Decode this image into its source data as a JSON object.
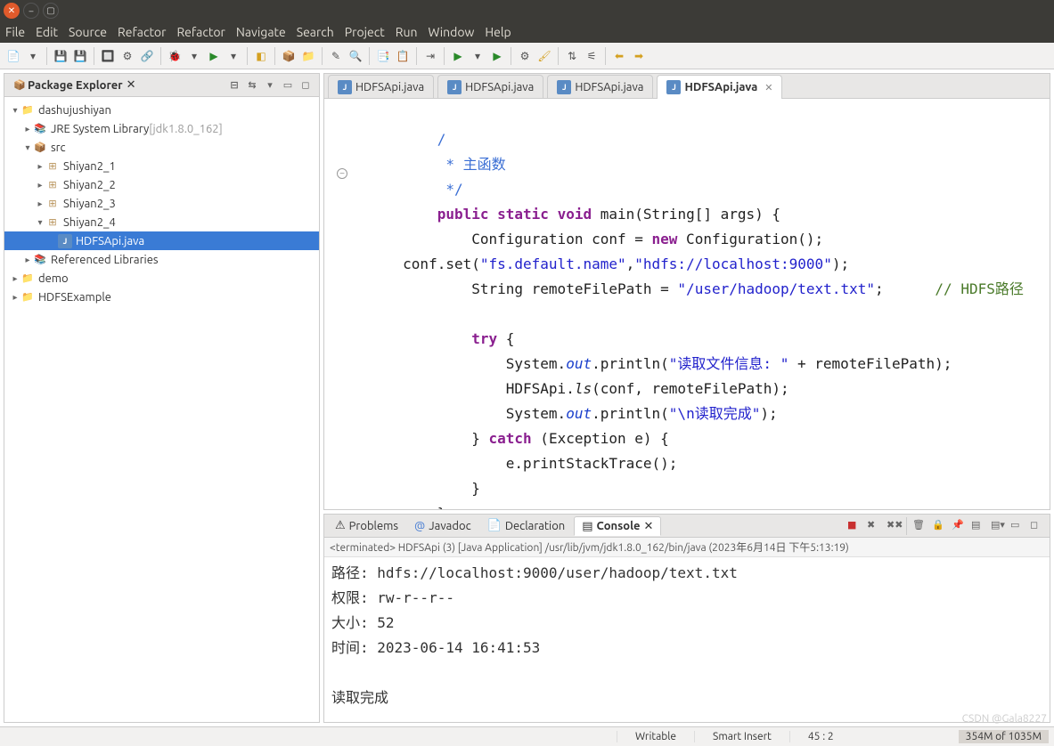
{
  "menu": [
    "File",
    "Edit",
    "Source",
    "Refactor",
    "Refactor",
    "Navigate",
    "Search",
    "Project",
    "Run",
    "Window",
    "Help"
  ],
  "sidebar": {
    "title": "Package Explorer",
    "project": "dashujushiyan",
    "jre": "JRE System Library",
    "jre_tag": "[jdk1.8.0_162]",
    "src": "src",
    "pkgs": [
      "Shiyan2_1",
      "Shiyan2_2",
      "Shiyan2_3",
      "Shiyan2_4"
    ],
    "file": "HDFSApi.java",
    "reflib": "Referenced Libraries",
    "demo": "demo",
    "hdfsex": "HDFSExample"
  },
  "tabs": {
    "t0": "HDFSApi.java",
    "t1": "HDFSApi.java",
    "t2": "HDFSApi.java",
    "t3": "HDFSApi.java"
  },
  "code": {
    "c0": "         /",
    "c1": "          * 主函数",
    "c2": "          */",
    "k_public": "public",
    "k_static": "static",
    "k_void": "void",
    "m_main": " main(String[] args) {",
    "l_conf1a": "             Configuration conf = ",
    "k_new": "new",
    "l_conf1b": " Configuration();",
    "l_set": "     conf.set(",
    "s_fs": "\"fs.default.name\"",
    "l_comma": ",",
    "s_hdfs": "\"hdfs://localhost:9000\"",
    "l_setend": ");",
    "l_rfa": "             String remoteFilePath = ",
    "s_path": "\"/user/hadoop/text.txt\"",
    "l_semi": ";",
    "c_hdfs": "      // HDFS路径",
    "k_try": "try",
    "l_tryopen": " {",
    "l_sysa": "                 System.",
    "f_out": "out",
    "l_sysb": ".println(",
    "s_read": "\"读取文件信息: \"",
    "l_sysc": " + remoteFilePath);",
    "l_lsa": "                 HDFSApi.",
    "m_ls": "ls",
    "l_lsb": "(conf, remoteFilePath);",
    "l_sys2a": "                 System.",
    "l_sys2b": ".println(",
    "s_done": "\"\\n读取完成\"",
    "l_sys2c": ");",
    "l_cb1": "             } ",
    "k_catch": "catch",
    "l_catch": " (Exception e) {",
    "l_pst": "                 e.printStackTrace();",
    "l_cb2": "             }",
    "l_cb3": "         }",
    "l_cb4": " }"
  },
  "bottom": {
    "problems": "Problems",
    "javadoc": "Javadoc",
    "decl": "Declaration",
    "console": "Console",
    "terminated": "<terminated> HDFSApi (3) [Java Application] /usr/lib/jvm/jdk1.8.0_162/bin/java (2023年6月14日 下午5:13:19)",
    "out": "路径: hdfs://localhost:9000/user/hadoop/text.txt\n权限: rw-r--r--\n大小: 52\n时间: 2023-06-14 16:41:53\n\n读取完成"
  },
  "status": {
    "writable": "Writable",
    "insert": "Smart Insert",
    "pos": "45 : 2",
    "heap": "354M of 1035M"
  },
  "watermark": "CSDN @Gala8227"
}
